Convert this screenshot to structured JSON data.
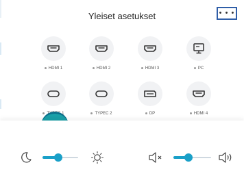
{
  "dialog": {
    "title": "Yleiset asetukset",
    "more_label": "• • •"
  },
  "sources": [
    {
      "label": "HDMI 1",
      "icon": "hdmi-icon"
    },
    {
      "label": "HDMI 2",
      "icon": "hdmi-icon"
    },
    {
      "label": "HDMI 3",
      "icon": "hdmi-icon"
    },
    {
      "label": "PC",
      "icon": "monitor-icon"
    },
    {
      "label": "TYPEC 1",
      "icon": "usb-c-icon"
    },
    {
      "label": "TYPEC 2",
      "icon": "usb-c-icon"
    },
    {
      "label": "DP",
      "icon": "displayport-icon"
    },
    {
      "label": "HDMI 4",
      "icon": "hdmi-icon"
    }
  ],
  "controls": {
    "brightness": {
      "level": 0.45,
      "low_icon": "moon-icon",
      "high_icon": "sun-icon"
    },
    "volume": {
      "level": 0.4,
      "low_icon": "speaker-mute-icon",
      "high_icon": "speaker-loud-icon"
    }
  },
  "colors": {
    "accent": "#1aa0c8",
    "focus_outline": "#2f5ea8"
  }
}
